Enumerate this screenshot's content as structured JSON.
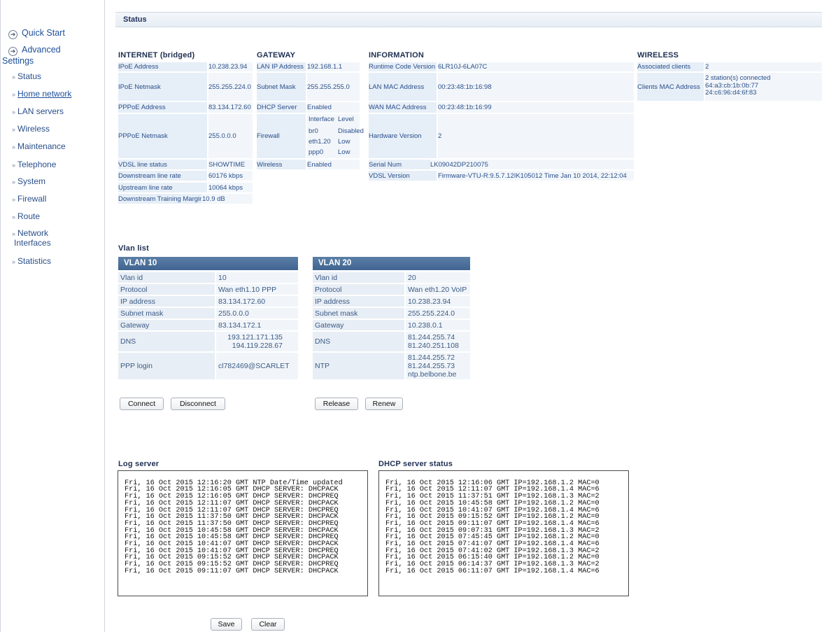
{
  "sidebar": {
    "quick_start": "Quick Start",
    "advanced_line1": "Advanced",
    "advanced_line2": "Settings",
    "items": [
      {
        "label": "Status"
      },
      {
        "label": "Home network"
      },
      {
        "label": "LAN servers"
      },
      {
        "label": "Wireless"
      },
      {
        "label": "Maintenance"
      },
      {
        "label": "Telephone"
      },
      {
        "label": "System"
      },
      {
        "label": "Firewall"
      },
      {
        "label": "Route"
      },
      {
        "label": "Network",
        "label2": "Interfaces"
      },
      {
        "label": "Statistics"
      }
    ]
  },
  "header": {
    "title": "Status"
  },
  "internet": {
    "title": "INTERNET (bridged)",
    "ipoe_address_label": "IPoE Address",
    "ipoe_address": "10.238.23.94",
    "ipoe_netmask_label": "IPoE Netmask",
    "ipoe_netmask": "255.255.224.0",
    "pppoe_address_label": "PPPoE Address",
    "pppoe_address": "83.134.172.60",
    "pppoe_netmask_label": "PPPoE Netmask",
    "pppoe_netmask": "255.0.0.0",
    "vdsl_status_label": "VDSL line status",
    "vdsl_status": "SHOWTIME",
    "down_rate_label": "Downstream line rate",
    "down_rate": "60176 kbps",
    "up_rate_label": "Upstream line rate",
    "up_rate": "10064 kbps",
    "down_margin_label": "Downstream Training Margin",
    "down_margin": "10.9 dB"
  },
  "gateway": {
    "title": "GATEWAY",
    "lan_ip_label": "LAN IP Address",
    "lan_ip": "192.168.1.1",
    "subnet_label": "Subnet Mask",
    "subnet": "255.255.255.0",
    "dhcp_label": "DHCP Server",
    "dhcp": "Enabled",
    "firewall_label": "Firewall",
    "fw_head_interface": "Interface",
    "fw_head_level": "Level",
    "fw_rows": [
      {
        "iface": "br0",
        "level": "Disabled"
      },
      {
        "iface": "eth1.20",
        "level": "Low"
      },
      {
        "iface": "ppp0",
        "level": "Low"
      }
    ],
    "wireless_label": "Wireless",
    "wireless": "Enabled"
  },
  "information": {
    "title": "INFORMATION",
    "runtime_label": "Runtime Code Version",
    "runtime": "6LR10J-6LA07C",
    "lan_mac_label": "LAN MAC Address",
    "lan_mac": "00:23:48:1b:16:98",
    "wan_mac_label": "WAN MAC Address",
    "wan_mac": "00:23:48:1b:16:99",
    "hw_label": "Hardware Version",
    "hw": "2",
    "serial_label": "Serial Num",
    "serial": "LK09042DP210075",
    "vdsl_ver_label": "VDSL Version",
    "vdsl_ver": "Firmware-VTU-R:9.5.7.12IK105012 Time Jan 10 2014, 22:12:04"
  },
  "wireless": {
    "title": "WIRELESS",
    "assoc_label": "Associated clients",
    "assoc": "2",
    "mac_label": "Clients MAC Address",
    "mac_line1": "2 station(s) connected",
    "mac_line2": "64:a3:cb:1b:0b:77",
    "mac_line3": "24:c6:96:d4:6f:83"
  },
  "vlan_list_title": "Vlan list",
  "vlan10": {
    "title": "VLAN 10",
    "rows": [
      {
        "label": "Vlan id",
        "value": "10"
      },
      {
        "label": "Protocol",
        "value": "Wan eth1.10 PPP"
      },
      {
        "label": "IP address",
        "value": "83.134.172.60"
      },
      {
        "label": "Subnet mask",
        "value": "255.0.0.0"
      },
      {
        "label": "Gateway",
        "value": "83.134.172.1"
      },
      {
        "label": "DNS",
        "value": "193.121.171.135",
        "value2": "194.119.228.67"
      },
      {
        "label": "PPP login",
        "value": "cl782469@SCARLET"
      }
    ],
    "btn1": "Connect",
    "btn2": "Disconnect"
  },
  "vlan20": {
    "title": "VLAN 20",
    "rows": [
      {
        "label": "Vlan id",
        "value": "20"
      },
      {
        "label": "Protocol",
        "value": "Wan eth1.20 VoIP"
      },
      {
        "label": "IP address",
        "value": "10.238.23.94"
      },
      {
        "label": "Subnet mask",
        "value": "255.255.224.0"
      },
      {
        "label": "Gateway",
        "value": "10.238.0.1"
      },
      {
        "label": "DNS",
        "value": "81.244.255.74",
        "value2": "81.240.251.108"
      },
      {
        "label": "NTP",
        "value": "81.244.255.72",
        "value2": "81.244.255.73",
        "value3": "ntp.belbone.be"
      }
    ],
    "btn1": "Release",
    "btn2": "Renew"
  },
  "log_server": {
    "title": "Log server",
    "lines": [
      "Fri, 16 Oct 2015 12:16:20 GMT NTP Date/Time updated",
      "Fri, 16 Oct 2015 12:16:05 GMT DHCP SERVER: DHCPACK",
      "Fri, 16 Oct 2015 12:16:05 GMT DHCP SERVER: DHCPREQ",
      "Fri, 16 Oct 2015 12:11:07 GMT DHCP SERVER: DHCPACK",
      "Fri, 16 Oct 2015 12:11:07 GMT DHCP SERVER: DHCPREQ",
      "Fri, 16 Oct 2015 11:37:50 GMT DHCP SERVER: DHCPACK",
      "Fri, 16 Oct 2015 11:37:50 GMT DHCP SERVER: DHCPREQ",
      "Fri, 16 Oct 2015 10:45:58 GMT DHCP SERVER: DHCPACK",
      "Fri, 16 Oct 2015 10:45:58 GMT DHCP SERVER: DHCPREQ",
      "Fri, 16 Oct 2015 10:41:07 GMT DHCP SERVER: DHCPACK",
      "Fri, 16 Oct 2015 10:41:07 GMT DHCP SERVER: DHCPREQ",
      "Fri, 16 Oct 2015 09:15:52 GMT DHCP SERVER: DHCPACK",
      "Fri, 16 Oct 2015 09:15:52 GMT DHCP SERVER: DHCPREQ",
      "Fri, 16 Oct 2015 09:11:07 GMT DHCP SERVER: DHCPACK"
    ],
    "save": "Save",
    "clear": "Clear"
  },
  "dhcp_status": {
    "title": "DHCP server status",
    "lines": [
      "Fri, 16 Oct 2015 12:16:06 GMT IP=192.168.1.2 MAC=0",
      "Fri, 16 Oct 2015 12:11:07 GMT IP=192.168.1.4 MAC=6",
      "Fri, 16 Oct 2015 11:37:51 GMT IP=192.168.1.3 MAC=2",
      "Fri, 16 Oct 2015 10:45:58 GMT IP=192.168.1.2 MAC=0",
      "Fri, 16 Oct 2015 10:41:07 GMT IP=192.168.1.4 MAC=6",
      "Fri, 16 Oct 2015 09:15:52 GMT IP=192.168.1.2 MAC=0",
      "Fri, 16 Oct 2015 09:11:07 GMT IP=192.168.1.4 MAC=6",
      "Fri, 16 Oct 2015 09:07:31 GMT IP=192.168.1.3 MAC=2",
      "Fri, 16 Oct 2015 07:45:45 GMT IP=192.168.1.2 MAC=0",
      "Fri, 16 Oct 2015 07:41:07 GMT IP=192.168.1.4 MAC=6",
      "Fri, 16 Oct 2015 07:41:02 GMT IP=192.168.1.3 MAC=2",
      "Fri, 16 Oct 2015 06:15:40 GMT IP=192.168.1.2 MAC=0",
      "Fri, 16 Oct 2015 06:14:37 GMT IP=192.168.1.3 MAC=2",
      "Fri, 16 Oct 2015 06:11:07 GMT IP=192.168.1.4 MAC=6"
    ]
  }
}
